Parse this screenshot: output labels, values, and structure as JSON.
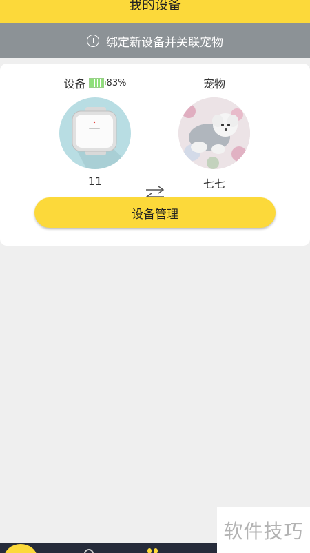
{
  "header": {
    "title": "我的设备"
  },
  "bind_bar": {
    "label": "绑定新设备并关联宠物",
    "icon": "plus-circle-icon"
  },
  "device": {
    "label": "设备",
    "battery": "83%",
    "battery_level": 0.83,
    "name": "11"
  },
  "pet": {
    "label": "宠物",
    "name": "七七"
  },
  "manage_button": {
    "label": "设备管理"
  },
  "watermark": {
    "text": "软件技巧"
  },
  "colors": {
    "accent": "#fcd93a",
    "bar": "#8c9296",
    "nav": "#262b3a",
    "background": "#efefef"
  }
}
